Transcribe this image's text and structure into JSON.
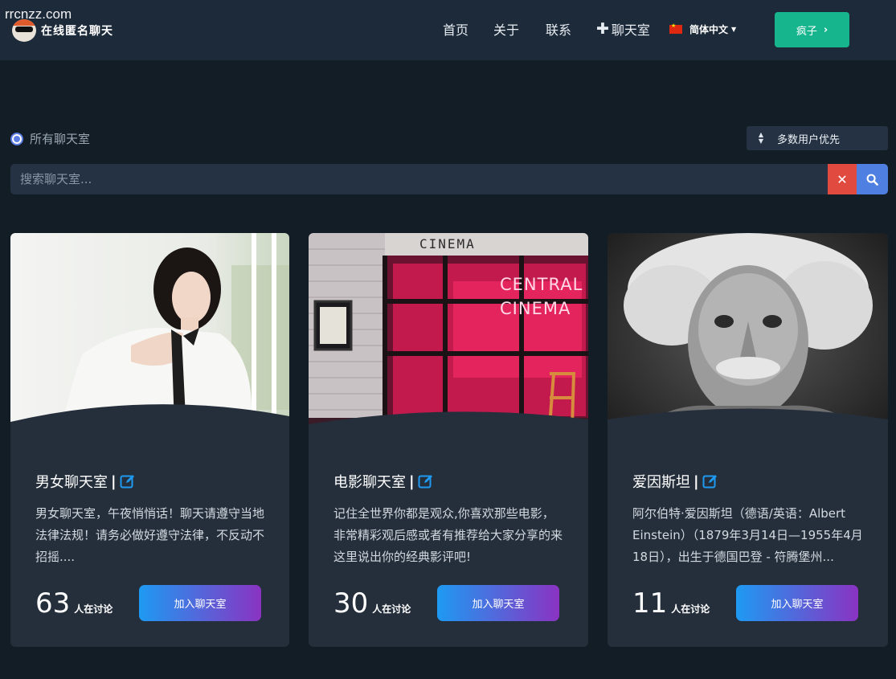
{
  "watermark": "rrcnzz.com",
  "logo": {
    "text": "在线匿名聊天",
    "icon": "penguin-sunglasses-icon"
  },
  "nav": {
    "home": "首页",
    "about": "关于",
    "contact": "联系",
    "rooms_icon": "plus-icon",
    "rooms": "聊天室",
    "language": "简体中文",
    "language_flag": "china-flag-icon",
    "crazy_button": "疯子"
  },
  "filter": {
    "all_rooms_label": "所有聊天室",
    "sort_selected": "多数用户优先"
  },
  "search": {
    "placeholder": "搜索聊天室...",
    "clear_icon": "close-icon",
    "search_icon": "search-icon"
  },
  "colors": {
    "header_bg": "#1d2a3a",
    "page_bg": "#131d26",
    "card_bg": "#252f3b",
    "green_button": "#16b58e",
    "clear_red": "#e04a3f",
    "search_blue": "#4f7fe0",
    "join_gradient_start": "#1e9af2",
    "join_gradient_end": "#8a33c2",
    "edit_icon": "#1e9af2"
  },
  "rooms": [
    {
      "title": "男女聊天室",
      "separator": "|",
      "description": "男女聊天室，午夜悄悄话！聊天请遵守当地法律法规！请务必做好遵守法律，不反动不招摇....",
      "count": "63",
      "count_label": "人在讨论",
      "join_label": "加入聊天室",
      "image": "woman-portrait-image"
    },
    {
      "title": "电影聊天室",
      "separator": "|",
      "description": "记住全世界你都是观众,你喜欢那些电影， 非常精彩观后感或者有推荐给大家分享的来这里说出你的经典影评吧!",
      "count": "30",
      "count_label": "人在讨论",
      "join_label": "加入聊天室",
      "image": "cinema-storefront-image",
      "image_sign_top": "CINEMA",
      "image_sign_neon_1": "CENTRAL",
      "image_sign_neon_2": "CINEMA"
    },
    {
      "title": "爱因斯坦",
      "separator": "|",
      "description": "阿尔伯特·爱因斯坦（德语/英语：Albert Einstein）（1879年3月14日—1955年4月18日），出生于德国巴登 - 符腾堡州...",
      "count": "11",
      "count_label": "人在讨论",
      "join_label": "加入聊天室",
      "image": "einstein-portrait-image"
    }
  ]
}
